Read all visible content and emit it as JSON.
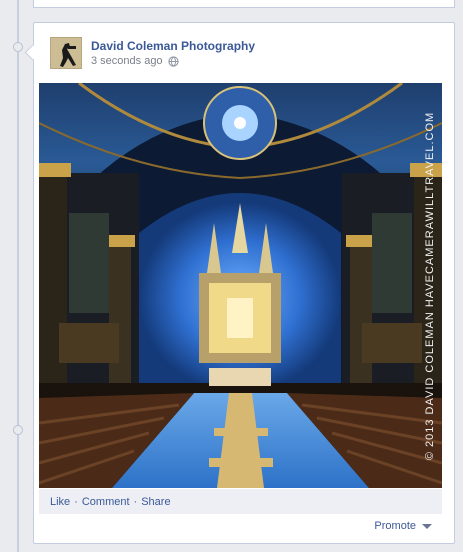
{
  "post": {
    "page_name": "David Coleman Photography",
    "timestamp": "3 seconds ago",
    "privacy_icon": "globe-icon",
    "photo_alt": "Basilica interior",
    "watermark": "© 2013 DAVID COLEMAN  HAVECAMERAWILLTRAVEL.COM"
  },
  "actions": {
    "like": "Like",
    "comment": "Comment",
    "share": "Share",
    "separator": "·",
    "promote": "Promote"
  },
  "colors": {
    "link": "#3b5998",
    "page_bg": "#e9ebee",
    "border": "#c4cde0"
  }
}
